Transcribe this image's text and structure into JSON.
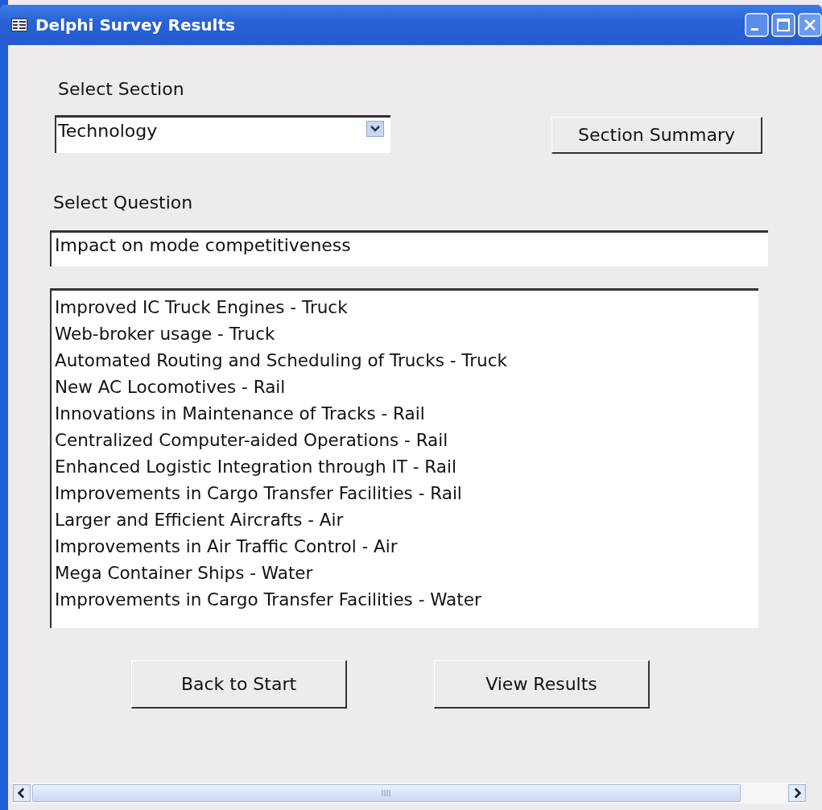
{
  "window": {
    "title": "Delphi Survey Results"
  },
  "section": {
    "label": "Select Section",
    "value": "Technology"
  },
  "section_summary_button": "Section Summary",
  "question": {
    "label": "Select Question",
    "value": "Impact on mode competitiveness"
  },
  "items": [
    {
      "label": "Improved IC Truck Engines - Truck"
    },
    {
      "label": "Web-broker usage - Truck"
    },
    {
      "label": "Automated Routing and Scheduling of Trucks - Truck"
    },
    {
      "label": "New AC Locomotives - Rail"
    },
    {
      "label": "Innovations in Maintenance of Tracks - Rail"
    },
    {
      "label": "Centralized Computer-aided Operations - Rail"
    },
    {
      "label": "Enhanced Logistic Integration through IT - Rail"
    },
    {
      "label": "Improvements in Cargo Transfer Facilities - Rail"
    },
    {
      "label": "Larger and Efficient Aircrafts - Air"
    },
    {
      "label": "Improvements in Air Traffic Control - Air"
    },
    {
      "label": "Mega Container Ships - Water"
    },
    {
      "label": "Improvements in Cargo Transfer Facilities - Water"
    }
  ],
  "buttons": [
    "Back to Start",
    "View Results"
  ]
}
